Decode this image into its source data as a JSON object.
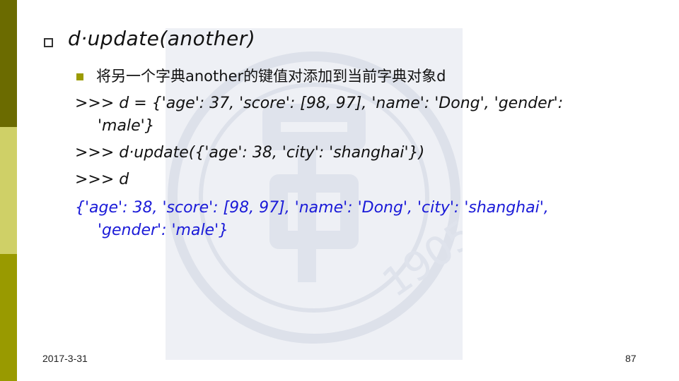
{
  "slide": {
    "title": "d·update(another)",
    "subtitle": "将另一个字典another的键值对添加到当前字典对象d",
    "code_lines": [
      ">>> d = {'age': 37, 'score': [98, 97], 'name': 'Dong', 'gender':",
      "'male'}",
      ">>> d·update({'age': 38, 'city': 'shanghai'})",
      ">>> d"
    ],
    "output_lines": [
      "{'age': 38, 'score': [98, 97], 'name': 'Dong', 'city': 'shanghai',",
      "'gender': 'male'}"
    ],
    "watermark_year": "1905"
  },
  "footer": {
    "date": "2017-3-31",
    "page_number": "87"
  },
  "colors": {
    "bar_top": "#6b6b00",
    "bar_mid": "#cfd067",
    "bar_bottom": "#999a00",
    "output_text": "#1a1ad8"
  }
}
